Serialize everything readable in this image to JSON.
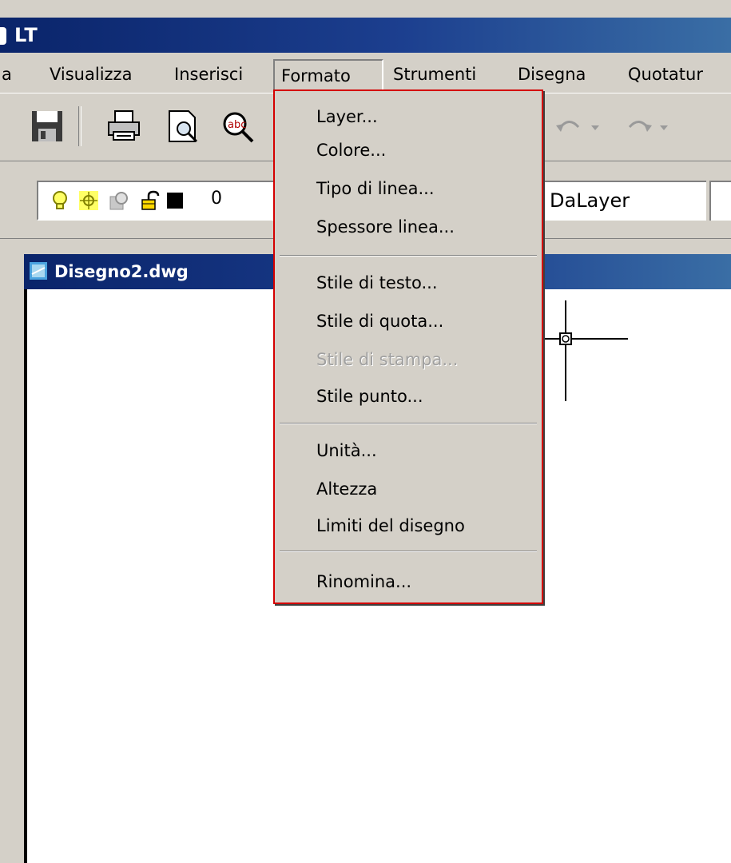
{
  "window": {
    "title": "LT"
  },
  "menubar": {
    "items": [
      {
        "label": "a"
      },
      {
        "label": "Visualizza"
      },
      {
        "label": "Inserisci"
      },
      {
        "label": "Formato"
      },
      {
        "label": "Strumenti"
      },
      {
        "label": "Disegna"
      },
      {
        "label": "Quotatur"
      }
    ]
  },
  "toolbar": {
    "icons": [
      "save-icon",
      "print-icon",
      "print-preview-icon",
      "spell-check-icon",
      "undo-icon",
      "redo-icon"
    ]
  },
  "layers_toolbar": {
    "layer_name": "0",
    "color_property": "DaLayer",
    "icons": [
      "lightbulb-icon",
      "freeze-sun-icon",
      "viewport-freeze-icon",
      "padlock-icon",
      "color-swatch-icon"
    ],
    "swatch_color": "#000000"
  },
  "document": {
    "title": "Disegno2.dwg"
  },
  "format_menu": {
    "items": [
      {
        "label": "Layer..."
      },
      {
        "label": "Colore..."
      },
      {
        "label": "Tipo di linea..."
      },
      {
        "label": "Spessore linea..."
      },
      {
        "label": "Stile di testo..."
      },
      {
        "label": "Stile di quota..."
      },
      {
        "label": "Stile di stampa...",
        "disabled": true
      },
      {
        "label": "Stile punto..."
      },
      {
        "label": "Unità..."
      },
      {
        "label": "Altezza"
      },
      {
        "label": "Limiti del disegno"
      },
      {
        "label": "Rinomina..."
      }
    ]
  },
  "colors": {
    "title_bar": "#0a246a",
    "menu_highlight_border": "#d40000",
    "face": "#d4d0c8"
  }
}
